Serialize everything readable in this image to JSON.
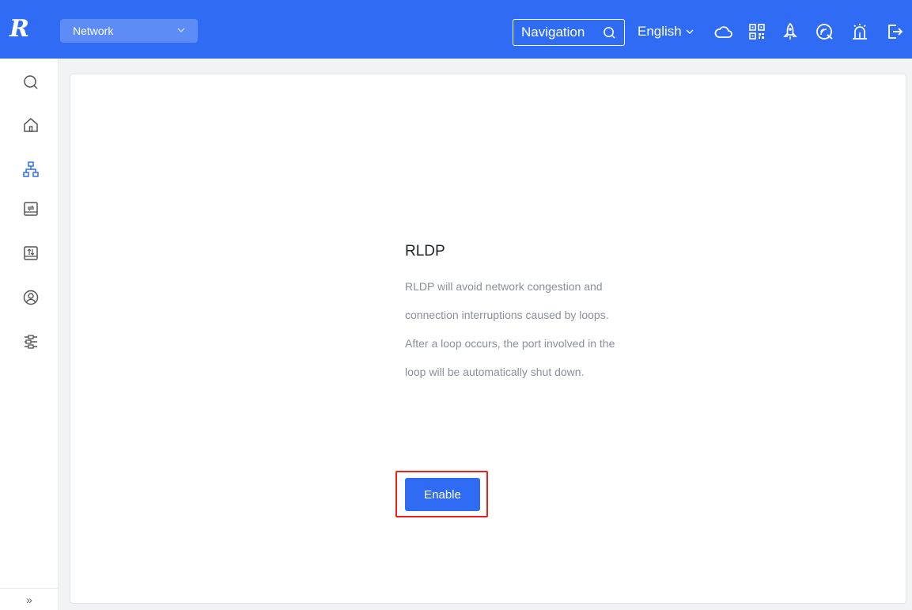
{
  "header": {
    "logo_text": "R",
    "network_select": "Network",
    "navigation_label": "Navigation",
    "language": "English",
    "icons": [
      "cloud-icon",
      "qr-code-icon",
      "rocket-icon",
      "wifi-scan-icon",
      "alarm-icon",
      "logout-icon"
    ],
    "accent_color": "#2f6cf3"
  },
  "sidebar": {
    "items": [
      "search-icon",
      "home-icon",
      "topology-icon",
      "switch-icon",
      "gateway-icon",
      "user-icon",
      "settings-sliders-icon"
    ],
    "active_item": "topology-icon",
    "expand_label": "»"
  },
  "feature": {
    "title": "RLDP",
    "description": "RLDP will avoid network congestion and connection interruptions caused by loops. After a loop occurs, the port involved in the loop will be automatically shut down.",
    "enable_label": "Enable"
  }
}
